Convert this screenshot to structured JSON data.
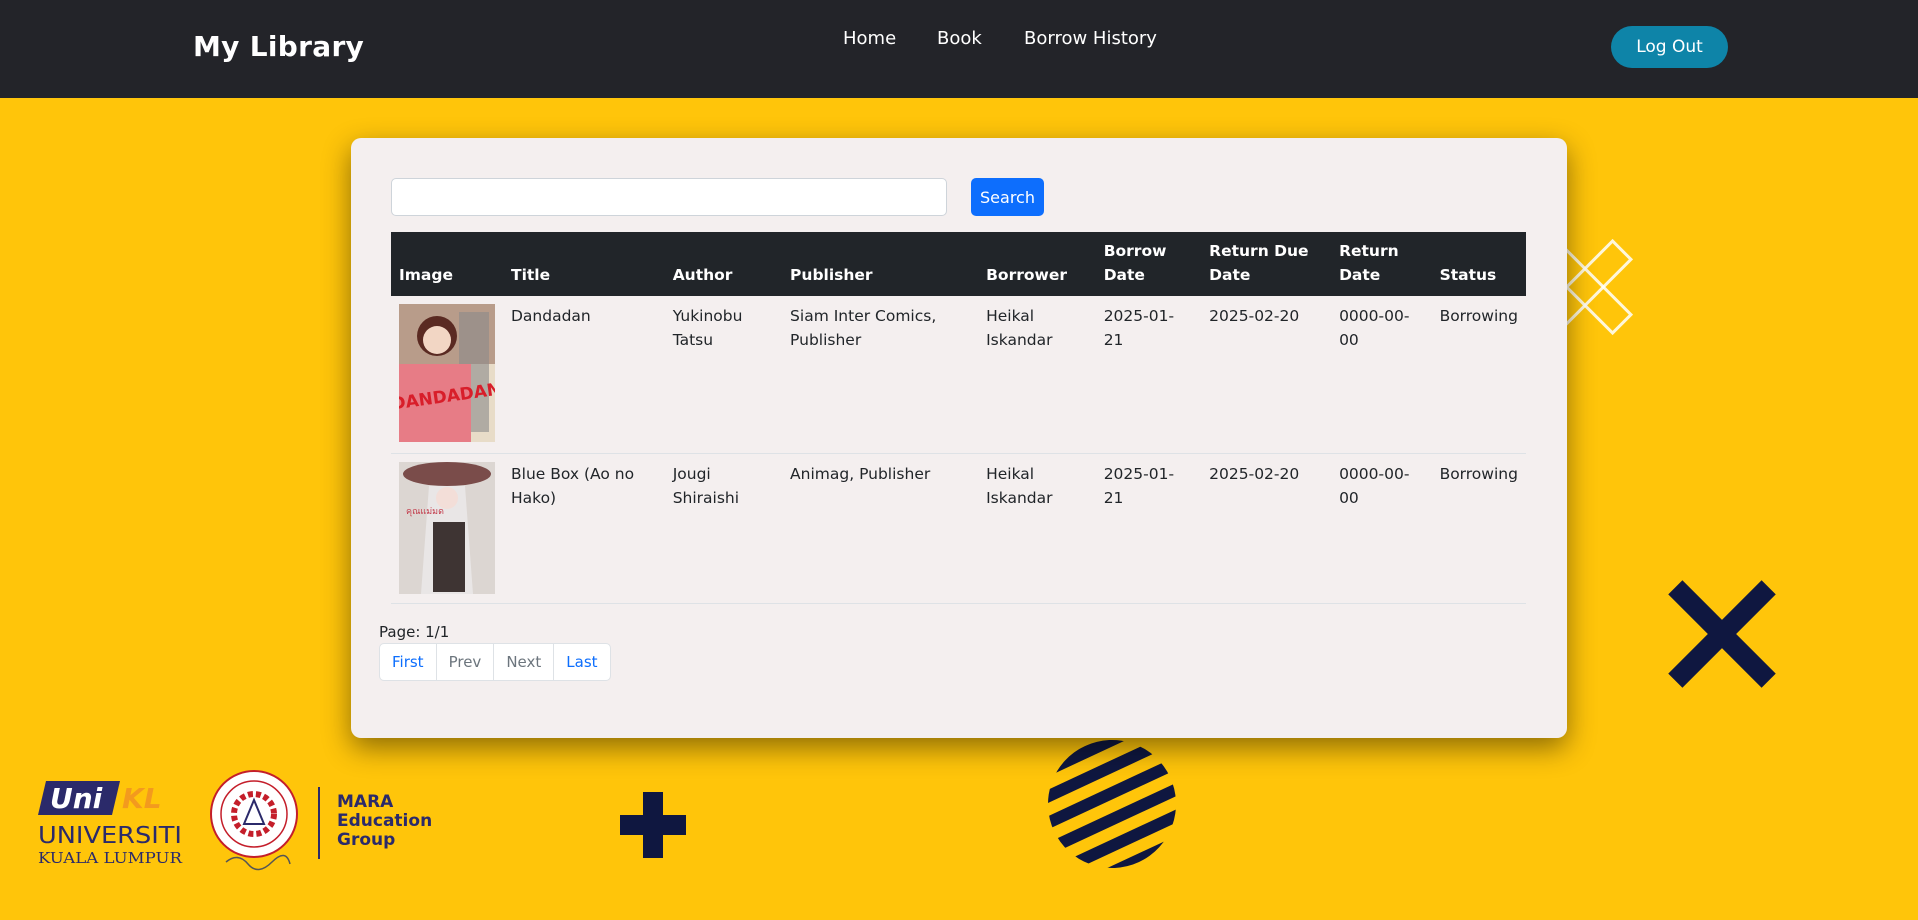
{
  "navbar": {
    "brand": "My Library",
    "links": [
      "Home",
      "Book",
      "Borrow History"
    ],
    "logout_label": "Log Out"
  },
  "search": {
    "placeholder": "",
    "value": "",
    "button_label": "Search"
  },
  "table": {
    "headers": {
      "image": "Image",
      "title": "Title",
      "author": "Author",
      "publisher": "Publisher",
      "borrower": "Borrower",
      "borrow_date": "Borrow Date",
      "return_due_date": "Return Due Date",
      "return_date": "Return Date",
      "status": "Status"
    },
    "rows": [
      {
        "title": "Dandadan",
        "author": "Yukinobu Tatsu",
        "publisher": "Siam Inter Comics, Publisher",
        "borrower": "Heikal Iskandar",
        "borrow_date": "2025-01-21",
        "return_due_date": "2025-02-20",
        "return_date": "0000-00-00",
        "status": "Borrowing",
        "cover_text": "DANDADAN"
      },
      {
        "title": "Blue Box (Ao no Hako)",
        "author": "Jougi Shiraishi",
        "publisher": "Animag, Publisher",
        "borrower": "Heikal Iskandar",
        "borrow_date": "2025-01-21",
        "return_due_date": "2025-02-20",
        "return_date": "0000-00-00",
        "status": "Borrowing",
        "cover_text": "คุณแม่มด"
      }
    ]
  },
  "pagination": {
    "page_label": "Page: 1/1",
    "first": "First",
    "prev": "Prev",
    "next": "Next",
    "last": "Last"
  },
  "footer": {
    "unikl_logo_text": "UniKL",
    "university_line1": "UNIVERSITI",
    "university_line2": "KUALA LUMPUR",
    "seal_text": "MAJLIS AMANAH RAKYAT MARA",
    "mara_line1": "MARA",
    "mara_line2": "Education",
    "mara_line3": "Group"
  },
  "colors": {
    "background": "#FFC50A",
    "navbar": "#232429",
    "logout": "#0E84A8",
    "primary": "#0D6EFD",
    "decoration": "#0F1740"
  },
  "icons": [
    "x-outline-icon",
    "x-icon",
    "plus-icon",
    "striped-circle-icon"
  ]
}
